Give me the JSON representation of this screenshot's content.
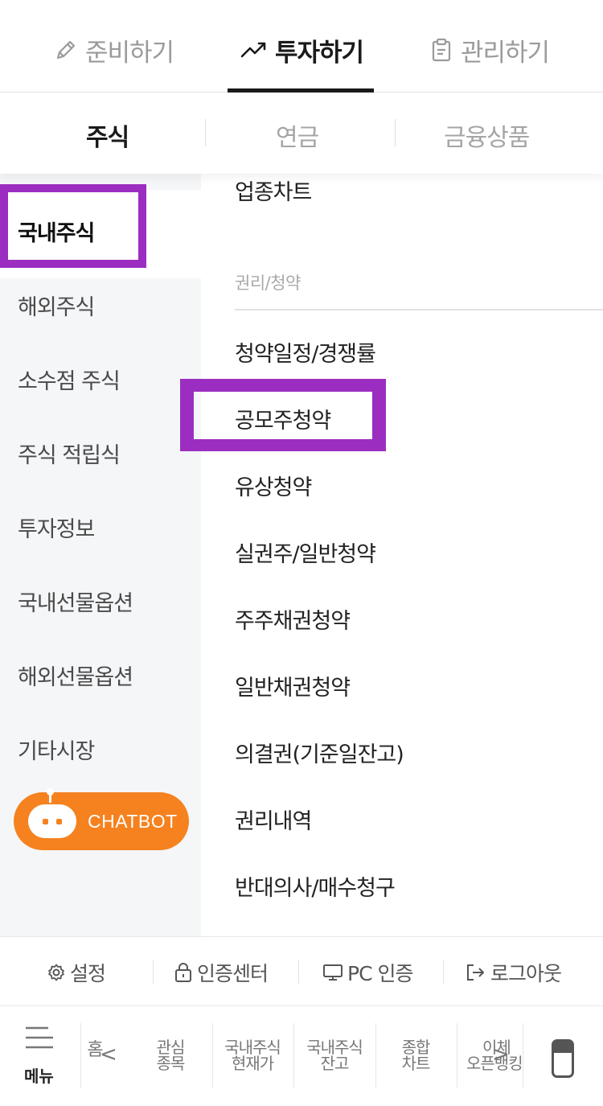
{
  "top_tabs": [
    {
      "label": "준비하기",
      "icon": "pencil-icon"
    },
    {
      "label": "투자하기",
      "icon": "trend-up-icon"
    },
    {
      "label": "관리하기",
      "icon": "clipboard-icon"
    }
  ],
  "sub_tabs": [
    "주식",
    "연금",
    "금융상품"
  ],
  "left_menu": {
    "items": [
      "국내주식",
      "해외주식",
      "소수점 주식",
      "주식 적립식",
      "투자정보",
      "국내선물옵션",
      "해외선물옵션",
      "기타시장"
    ],
    "active": "국내주식"
  },
  "chatbot_label": "CHATBOT",
  "right_menu": {
    "top_item": "업종차트",
    "section_title": "권리/청약",
    "items": [
      "청약일정/경쟁률",
      "공모주청약",
      "유상청약",
      "실권주/일반청약",
      "주주채권청약",
      "일반채권청약",
      "의결권(기준일잔고)",
      "권리내역",
      "반대의사/매수청구"
    ]
  },
  "footer_links": {
    "settings": "설정",
    "cert_center": "인증센터",
    "pc_cert": "PC 인증",
    "logout": "로그아웃"
  },
  "bottom_nav": {
    "menu_label": "메뉴",
    "home": "홈",
    "items": [
      {
        "line1": "관심",
        "line2": "종목"
      },
      {
        "line1": "국내주식",
        "line2": "현재가"
      },
      {
        "line1": "국내주식",
        "line2": "잔고"
      },
      {
        "line1": "종합",
        "line2": "차트"
      },
      {
        "line1": "이체",
        "line2": "오픈뱅킹"
      }
    ],
    "prev_arrow": "<",
    "next_arrow": ">"
  },
  "colors": {
    "highlight": "#9b2ec0",
    "chatbot": "#f5821f",
    "left_bg": "#f5f6f8"
  }
}
